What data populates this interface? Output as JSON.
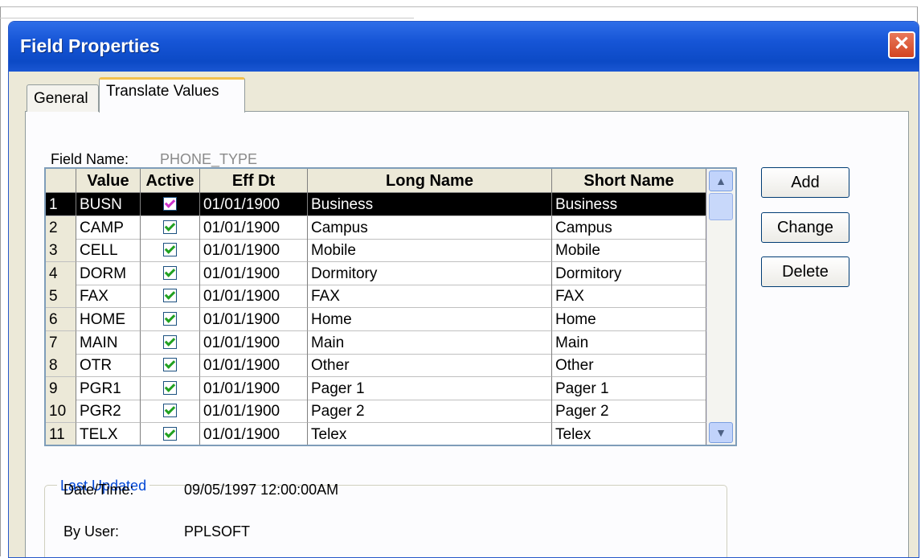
{
  "window": {
    "title": "Field Properties",
    "close_label": "✕"
  },
  "tabs": [
    {
      "label": "General"
    },
    {
      "label": "Translate Values"
    }
  ],
  "field_name": {
    "label": "Field Name:",
    "value": "PHONE_TYPE"
  },
  "grid": {
    "columns": [
      "Value",
      "Active",
      "Eff Dt",
      "Long Name",
      "Short Name"
    ],
    "rows": [
      {
        "num": "1",
        "value": "BUSN",
        "active": true,
        "eff_dt": "01/01/1900",
        "long_name": "Business",
        "short_name": "Business"
      },
      {
        "num": "2",
        "value": "CAMP",
        "active": true,
        "eff_dt": "01/01/1900",
        "long_name": "Campus",
        "short_name": "Campus"
      },
      {
        "num": "3",
        "value": "CELL",
        "active": true,
        "eff_dt": "01/01/1900",
        "long_name": "Mobile",
        "short_name": "Mobile"
      },
      {
        "num": "4",
        "value": "DORM",
        "active": true,
        "eff_dt": "01/01/1900",
        "long_name": "Dormitory",
        "short_name": "Dormitory"
      },
      {
        "num": "5",
        "value": "FAX",
        "active": true,
        "eff_dt": "01/01/1900",
        "long_name": "FAX",
        "short_name": "FAX"
      },
      {
        "num": "6",
        "value": "HOME",
        "active": true,
        "eff_dt": "01/01/1900",
        "long_name": "Home",
        "short_name": "Home"
      },
      {
        "num": "7",
        "value": "MAIN",
        "active": true,
        "eff_dt": "01/01/1900",
        "long_name": "Main",
        "short_name": "Main"
      },
      {
        "num": "8",
        "value": "OTR",
        "active": true,
        "eff_dt": "01/01/1900",
        "long_name": "Other",
        "short_name": "Other"
      },
      {
        "num": "9",
        "value": "PGR1",
        "active": true,
        "eff_dt": "01/01/1900",
        "long_name": "Pager 1",
        "short_name": "Pager 1"
      },
      {
        "num": "10",
        "value": "PGR2",
        "active": true,
        "eff_dt": "01/01/1900",
        "long_name": "Pager 2",
        "short_name": "Pager 2"
      },
      {
        "num": "11",
        "value": "TELX",
        "active": true,
        "eff_dt": "01/01/1900",
        "long_name": "Telex",
        "short_name": "Telex"
      }
    ],
    "selected_row": 1
  },
  "buttons": {
    "add": "Add",
    "change": "Change",
    "delete": "Delete"
  },
  "last_updated": {
    "legend": "Last Updated",
    "date_time_label": "Date/Time:",
    "date_time_value": "09/05/1997 12:00:00AM",
    "by_user_label": "By User:",
    "by_user_value": "PPLSOFT"
  },
  "colors": {
    "title_bar": "#0c4ac6",
    "selection": "#000000",
    "group_legend": "#0046d5",
    "checkmark": "#21a121"
  }
}
